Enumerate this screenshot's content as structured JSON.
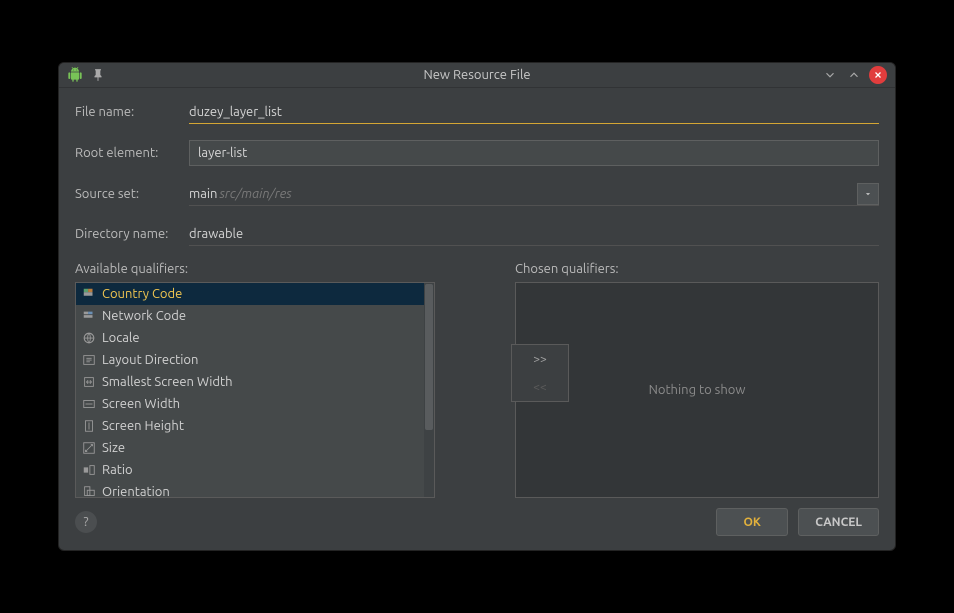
{
  "title": "New Resource File",
  "form": {
    "file_name_label": "File name:",
    "file_name_value": "duzey_layer_list",
    "root_element_label": "Root element:",
    "root_element_value": "layer-list",
    "source_set_label": "Source set:",
    "source_set_main": "main",
    "source_set_hint": " src/main/res",
    "directory_label": "Directory name:",
    "directory_value": "drawable"
  },
  "qualifiers": {
    "available_label": "Available qualifiers:",
    "chosen_label": "Chosen qualifiers:",
    "nothing_to_show": "Nothing to show",
    "items": [
      "Country Code",
      "Network Code",
      "Locale",
      "Layout Direction",
      "Smallest Screen Width",
      "Screen Width",
      "Screen Height",
      "Size",
      "Ratio",
      "Orientation"
    ]
  },
  "transfer": {
    "add": ">>",
    "remove": "<<"
  },
  "buttons": {
    "ok": "OK",
    "cancel": "CANCEL",
    "help": "?"
  }
}
